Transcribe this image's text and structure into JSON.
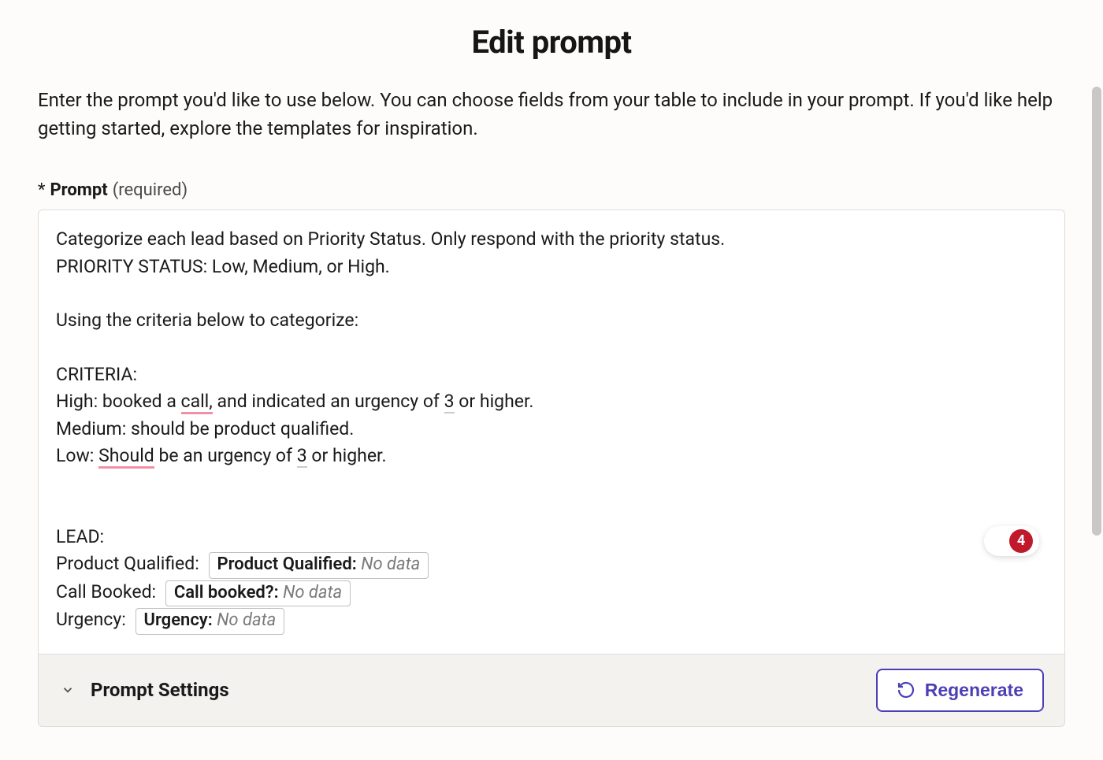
{
  "header": {
    "title": "Edit prompt",
    "intro": "Enter the prompt you'd like to use below. You can choose fields from your table to include in your prompt. If you'd like help getting started, explore the templates for inspiration."
  },
  "prompt_field": {
    "asterisk": "*",
    "label": "Prompt",
    "required_suffix": "(required)"
  },
  "prompt_body": {
    "line1": "Categorize each lead based on Priority Status. Only respond with the priority status.",
    "line2": "PRIORITY STATUS: Low, Medium, or High.",
    "line3": "Using the criteria below to categorize:",
    "criteria_header": "CRITERIA:",
    "high_pre": "High: booked a ",
    "high_call": "call,",
    "high_mid": " and indicated an urgency of ",
    "high_3": "3",
    "high_post": " or higher.",
    "medium": "Medium: should be product qualified.",
    "low_pre": "Low: ",
    "low_should": "Should",
    "low_mid": " be an urgency of ",
    "low_3": "3",
    "low_post": " or higher.",
    "lead_header": "LEAD:"
  },
  "lead_rows": [
    {
      "label": "Product Qualified: ",
      "chip_label": "Product Qualified: ",
      "chip_value": "No data"
    },
    {
      "label": "Call Booked: ",
      "chip_label": "Call booked?: ",
      "chip_value": "No data"
    },
    {
      "label": "Urgency: ",
      "chip_label": "Urgency: ",
      "chip_value": "No data"
    }
  ],
  "footer": {
    "settings_label": "Prompt Settings",
    "regenerate_label": "Regenerate"
  },
  "badge": {
    "count": "4"
  }
}
